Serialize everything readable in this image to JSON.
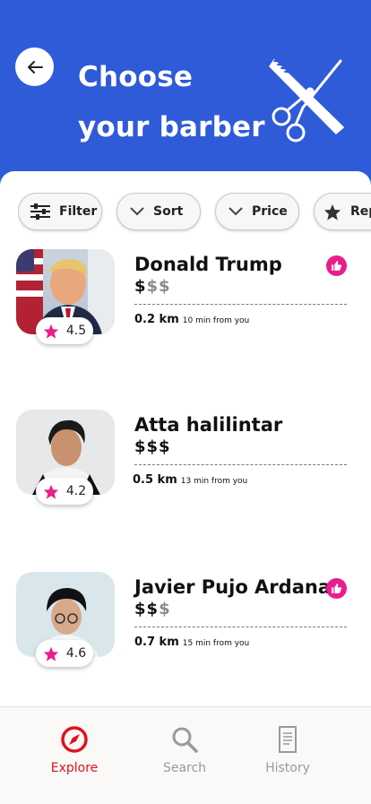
{
  "header": {
    "title": "Choose your barber"
  },
  "filters": [
    {
      "label": "Filter",
      "icon": "sliders-icon"
    },
    {
      "label": "Sort",
      "icon": "chevron-down-icon"
    },
    {
      "label": "Price",
      "icon": "chevron-down-icon"
    },
    {
      "label": "Repu",
      "icon": "star-icon"
    }
  ],
  "barbers": [
    {
      "name": "Donald Trump",
      "rating": "4.5",
      "price_on": "$",
      "price_off": "$$",
      "distance": "0.2 km",
      "eta": "10 min from you",
      "favorite": true
    },
    {
      "name": "Atta halilintar",
      "rating": "4.2",
      "price_on": "$$$",
      "price_off": "",
      "distance": "0.5 km",
      "eta": "13 min from you",
      "favorite": false
    },
    {
      "name": "Javier Pujo Ardana",
      "rating": "4.6",
      "price_on": "$$",
      "price_off": "$",
      "distance": "0.7 km",
      "eta": "15 min from you",
      "favorite": true
    }
  ],
  "nav": [
    {
      "label": "Explore",
      "icon": "compass-icon",
      "active": true
    },
    {
      "label": "Search",
      "icon": "search-icon",
      "active": false
    },
    {
      "label": "History",
      "icon": "document-icon",
      "active": false
    }
  ],
  "colors": {
    "primary": "#2f5ad8",
    "accent": "#e91e8c",
    "active_nav": "#e0121a"
  }
}
